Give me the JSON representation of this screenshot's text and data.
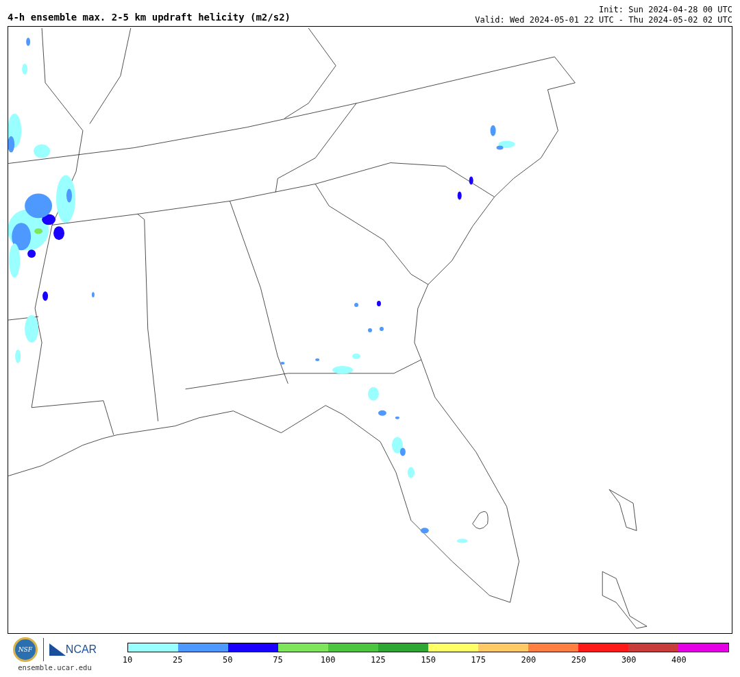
{
  "title": "4-h ensemble max. 2-5 km updraft helicity (m2/s2)",
  "init": "Init: Sun 2024-04-28 00 UTC",
  "valid": "Valid: Wed 2024-05-01 22 UTC - Thu 2024-05-02 02 UTC",
  "logos": {
    "nsf": "NSF",
    "ncar": "NCAR"
  },
  "site": "ensemble.ucar.edu",
  "legend": {
    "bins": [
      {
        "color": "#99ffff",
        "tick": "10"
      },
      {
        "color": "#4d99ff",
        "tick": "25"
      },
      {
        "color": "#1a00ff",
        "tick": "50"
      },
      {
        "color": "#7de65a",
        "tick": "75"
      },
      {
        "color": "#4cc63f",
        "tick": "100"
      },
      {
        "color": "#2ea632",
        "tick": "125"
      },
      {
        "color": "#ffff66",
        "tick": "150"
      },
      {
        "color": "#ffc966",
        "tick": "175"
      },
      {
        "color": "#ff8040",
        "tick": "200"
      },
      {
        "color": "#ff1a1a",
        "tick": "250"
      },
      {
        "color": "#c83c3c",
        "tick": "300"
      },
      {
        "color": "#e600e6",
        "tick": "400"
      }
    ]
  }
}
